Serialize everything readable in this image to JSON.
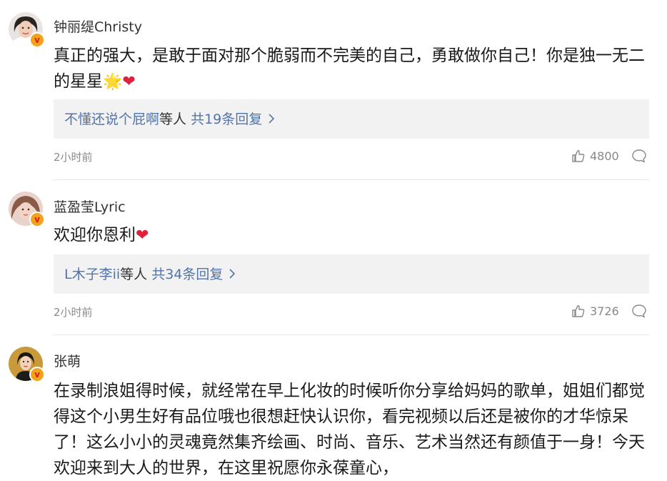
{
  "comments": [
    {
      "username": "钟丽缇Christy",
      "text_main": "真正的强大，是敢于面对那个脆弱而不完美的自己，勇敢做你自己！你是独一无二的星星",
      "star_emoji": "🌟",
      "heart_emoji": "❤",
      "reply_users": "不懂还说个屁啊",
      "reply_etc": "等人",
      "reply_count": "共19条回复",
      "time": "2小时前",
      "likes": "4800",
      "verified_badge": "v"
    },
    {
      "username": "蓝盈莹Lyric",
      "text_main": "欢迎你恩利",
      "heart_emoji": "❤",
      "reply_users": "L木子李ii",
      "reply_etc": "等人",
      "reply_count": "共34条回复",
      "time": "2小时前",
      "likes": "3726",
      "verified_badge": "v"
    },
    {
      "username": "张萌",
      "text_main": "在录制浪姐得时候，就经常在早上化妆的时候听你分享给妈妈的歌单，姐姐们都觉得这个小男生好有品位哦也很想赶快认识你，看完视频以后还是被你的才华惊呆了！这么小小的灵魂竟然集齐绘画、时尚、音乐、艺术当然还有颜值于一身！今天欢迎来到大人的世界，在这里祝愿你永葆童心，",
      "verified_badge": "v"
    }
  ],
  "icons": {
    "chevron": "chevron-right-icon",
    "like": "thumbs-up-icon",
    "comment": "comment-bubble-icon"
  },
  "colors": {
    "link": "#5274a8",
    "badge": "#f3a21e",
    "reply_bg": "#f2f2f2"
  }
}
